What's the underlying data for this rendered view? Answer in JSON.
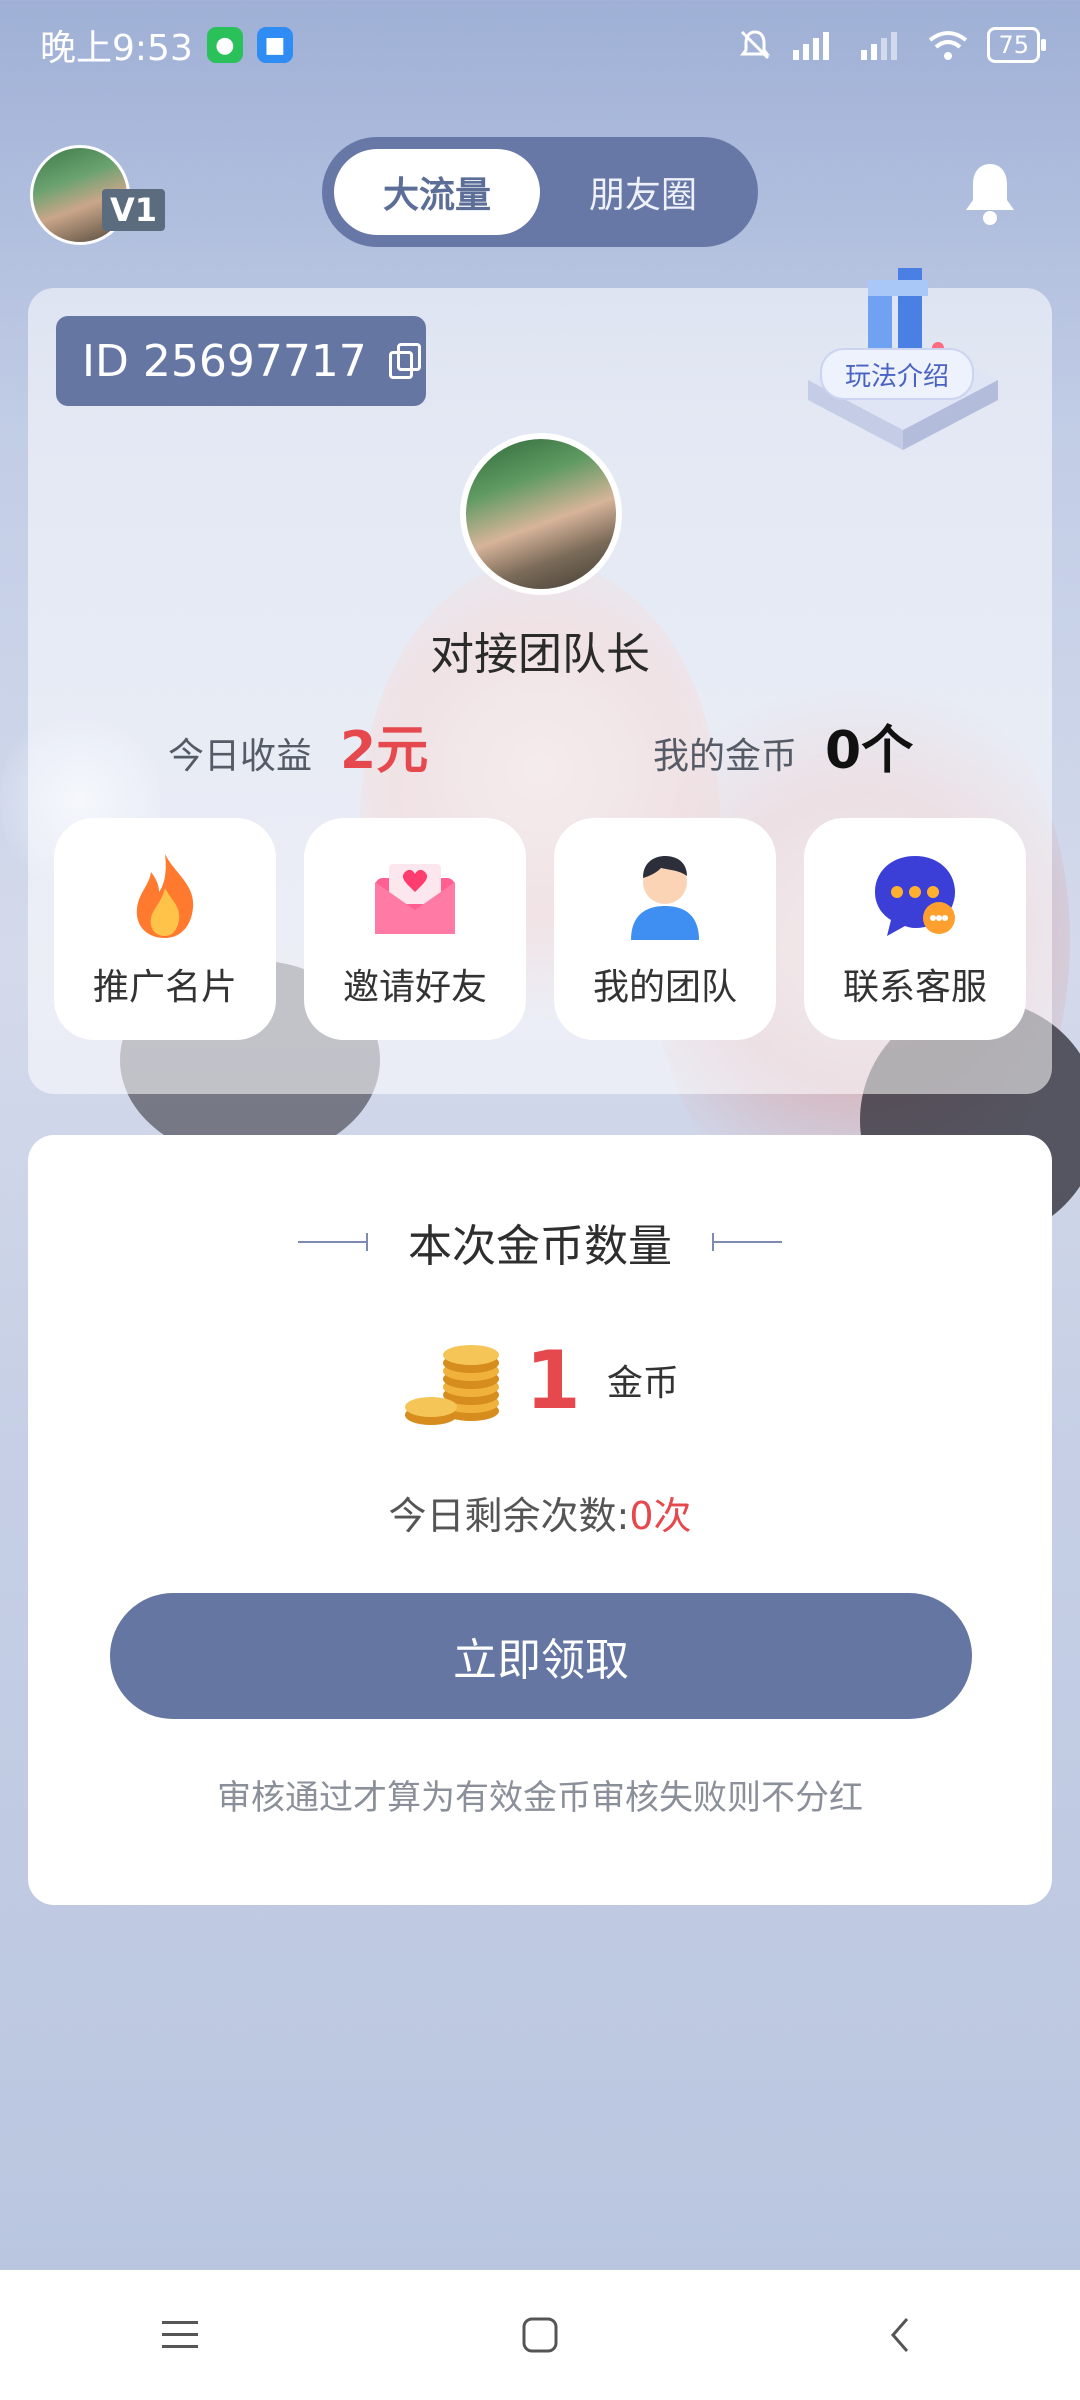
{
  "status_bar": {
    "time": "晚上9:53",
    "battery": "75"
  },
  "header": {
    "level": "V1",
    "tabs": [
      {
        "label": "大流量",
        "active": true
      },
      {
        "label": "朋友圈",
        "active": false
      }
    ]
  },
  "profile": {
    "id_text": "ID 25697717",
    "rules_label": "玩法介绍",
    "leader_name": "对接团队长",
    "earnings_label": "今日收益",
    "earnings_value": "2元",
    "coins_label": "我的金币",
    "coins_value": "0个"
  },
  "actions": [
    {
      "label": "推广名片",
      "icon": "fire-icon"
    },
    {
      "label": "邀请好友",
      "icon": "envelope-heart-icon"
    },
    {
      "label": "我的团队",
      "icon": "person-icon"
    },
    {
      "label": "联系客服",
      "icon": "chat-bubble-icon"
    }
  ],
  "coin_card": {
    "title": "本次金币数量",
    "amount": "1",
    "unit": "金币",
    "remaining_label": "今日剩余次数:",
    "remaining_value": "0次",
    "claim_button": "立即领取",
    "disclaimer": "审核通过才算为有效金币审核失败则不分红"
  },
  "colors": {
    "accent": "#6676a3",
    "red": "#e5484d"
  }
}
